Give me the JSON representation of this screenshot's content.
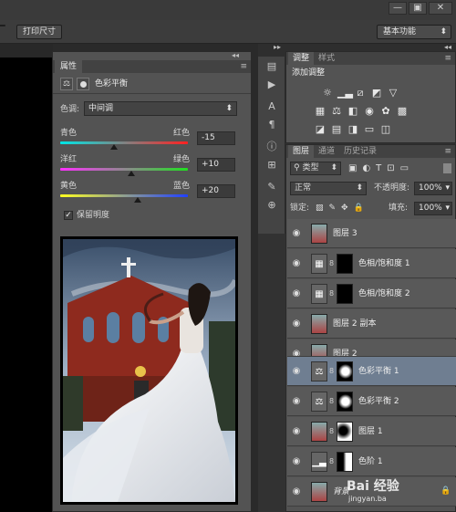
{
  "app": {
    "print_size_label": "打印尺寸",
    "workspace_label": "基本功能",
    "window_controls": [
      "—",
      "▣",
      "✕"
    ]
  },
  "properties": {
    "tab_label": "属性",
    "title": "色彩平衡",
    "tone_label": "色调:",
    "tone_value": "中间调",
    "sliders": [
      {
        "left": "青色",
        "right": "红色",
        "value": "-15",
        "fraction": 0.42
      },
      {
        "left": "洋红",
        "right": "绿色",
        "value": "+10",
        "fraction": 0.56
      },
      {
        "left": "黄色",
        "right": "蓝色",
        "value": "+20",
        "fraction": 0.61
      }
    ],
    "preserve_luminosity_label": "保留明度",
    "preserve_luminosity_checked": true
  },
  "adjustments_panel": {
    "tabs": [
      "调整",
      "样式"
    ],
    "title": "添加调整",
    "row1_icons": [
      "brightness-icon",
      "levels-icon",
      "curves-icon",
      "exposure-icon",
      "vibrance-icon"
    ],
    "row2_icons": [
      "hue-sat-icon",
      "color-balance-icon",
      "bw-icon",
      "photo-filter-icon",
      "channel-mixer-icon",
      "color-lookup-icon"
    ],
    "row3_icons": [
      "invert-icon",
      "posterize-icon",
      "threshold-icon",
      "gradient-map-icon",
      "selective-color-icon"
    ]
  },
  "layers_panel": {
    "tabs": [
      "图层",
      "通道",
      "历史记录"
    ],
    "filter_label": "类型",
    "blend_mode": "正常",
    "opacity_label": "不透明度:",
    "opacity_value": "100%",
    "lock_label": "锁定:",
    "fill_label": "填充:",
    "fill_value": "100%",
    "layers": [
      {
        "name": "图层 3",
        "type": "pixel",
        "selected": false
      },
      {
        "name": "色相/饱和度 1",
        "type": "adjustment",
        "selected": false
      },
      {
        "name": "色相/饱和度 2",
        "type": "adjustment",
        "selected": false
      },
      {
        "name": "图层 2 副本",
        "type": "pixel",
        "selected": false
      },
      {
        "name": "图层 2",
        "type": "pixel",
        "selected": false
      },
      {
        "name": "色彩平衡 1",
        "type": "balance",
        "selected": true
      },
      {
        "name": "色彩平衡 2",
        "type": "balance",
        "selected": false
      },
      {
        "name": "图层 1",
        "type": "pixel-mask",
        "selected": false
      },
      {
        "name": "色阶 1",
        "type": "levels",
        "selected": false
      },
      {
        "name": "背景",
        "type": "background",
        "selected": false
      }
    ]
  },
  "watermark": {
    "text": "Bai 经验",
    "url": "jingyan.ba"
  }
}
